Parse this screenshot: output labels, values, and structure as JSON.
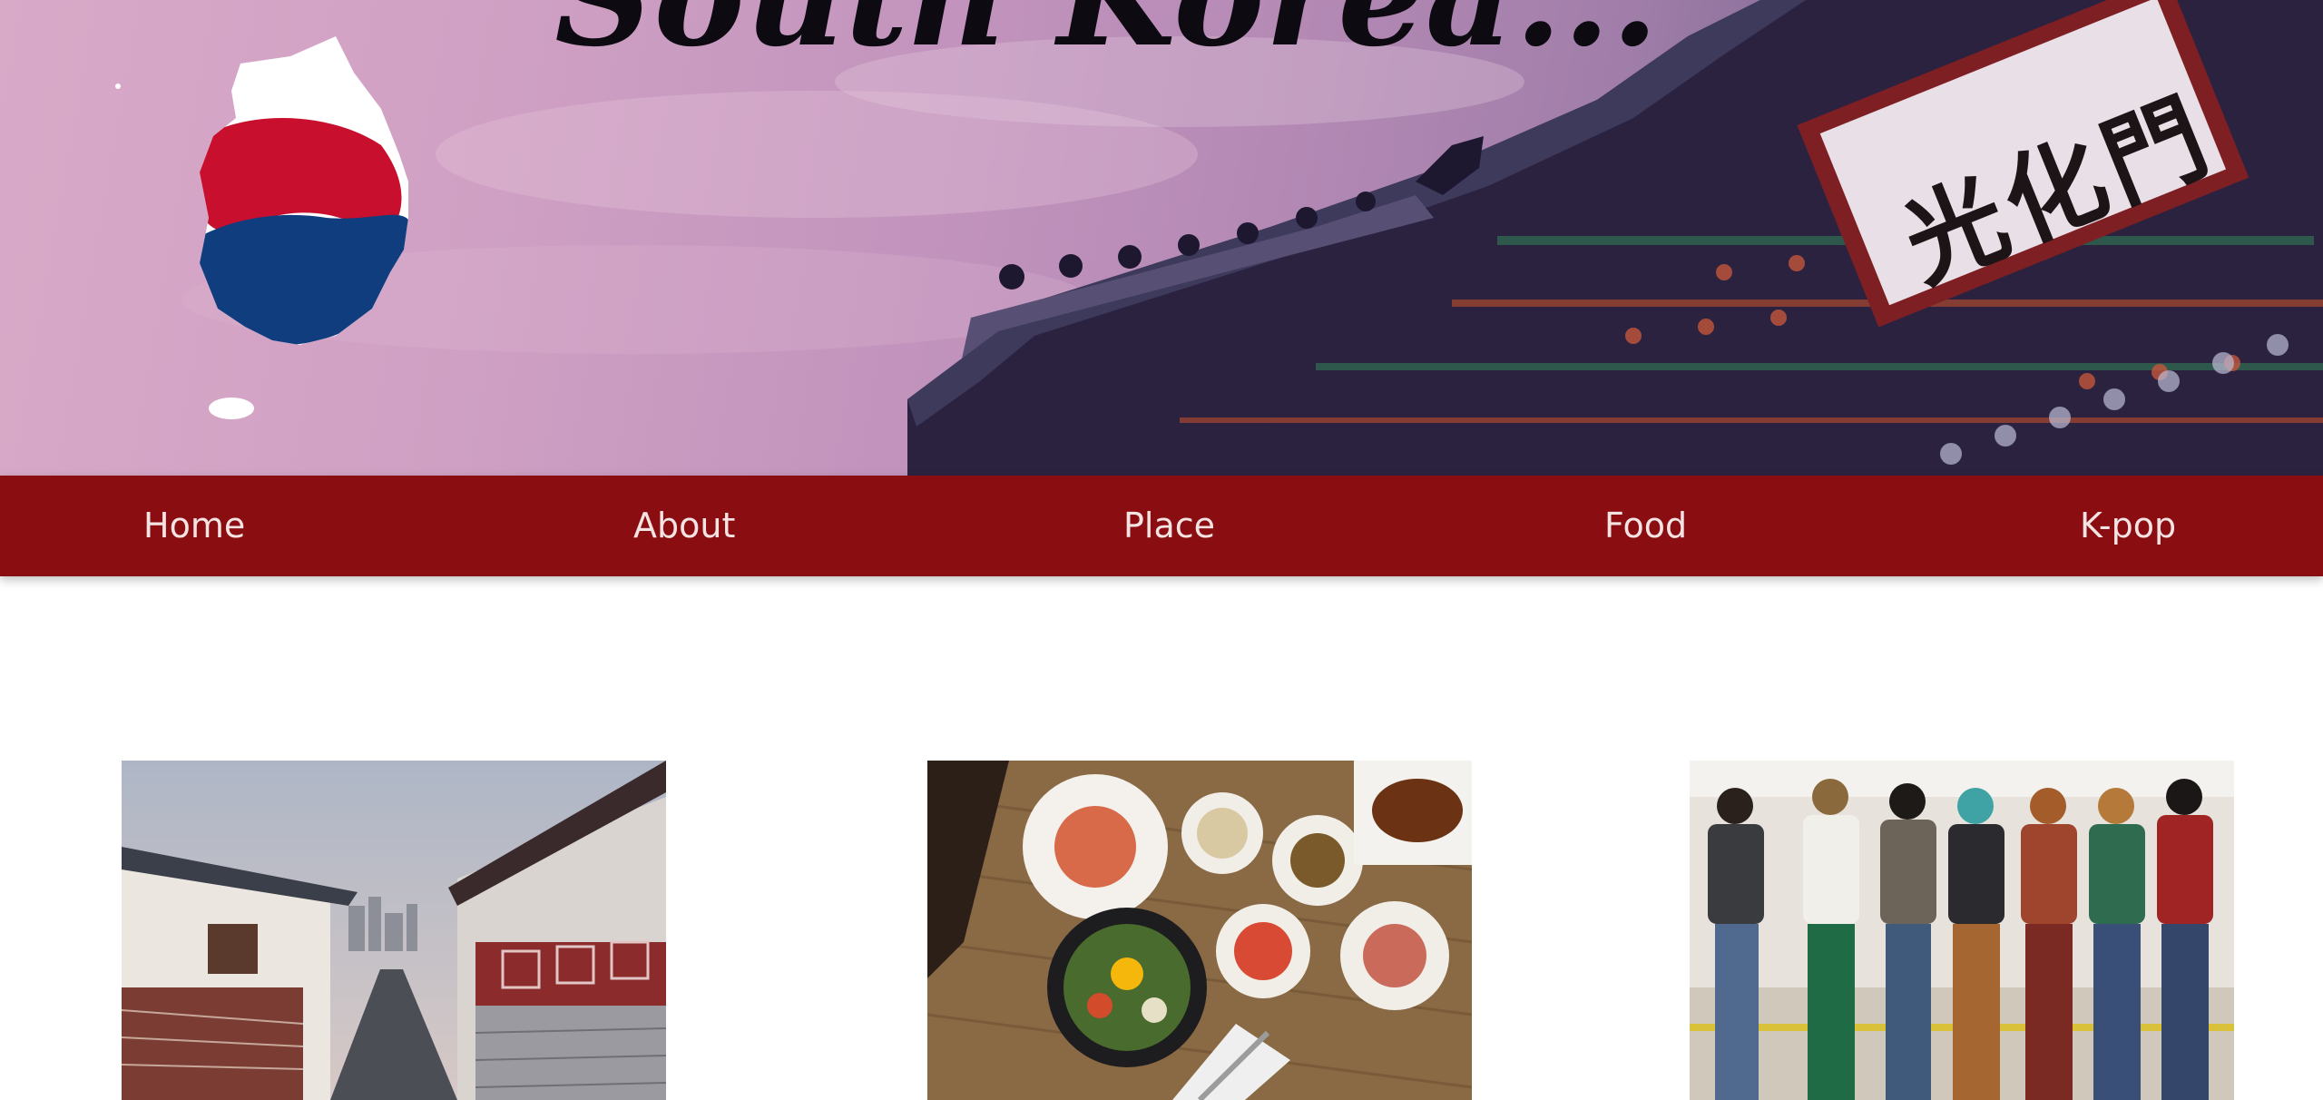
{
  "hero": {
    "title": "South Korea...",
    "gate_sign": "光化門"
  },
  "nav": {
    "items": [
      {
        "label": "Home"
      },
      {
        "label": "About"
      },
      {
        "label": "Place"
      },
      {
        "label": "Food"
      },
      {
        "label": "K-pop"
      }
    ]
  },
  "colors": {
    "nav_background": "#8a0d12",
    "nav_text": "#f3e3e3",
    "flag_red": "#c8102e",
    "flag_blue": "#0f3d7e"
  }
}
